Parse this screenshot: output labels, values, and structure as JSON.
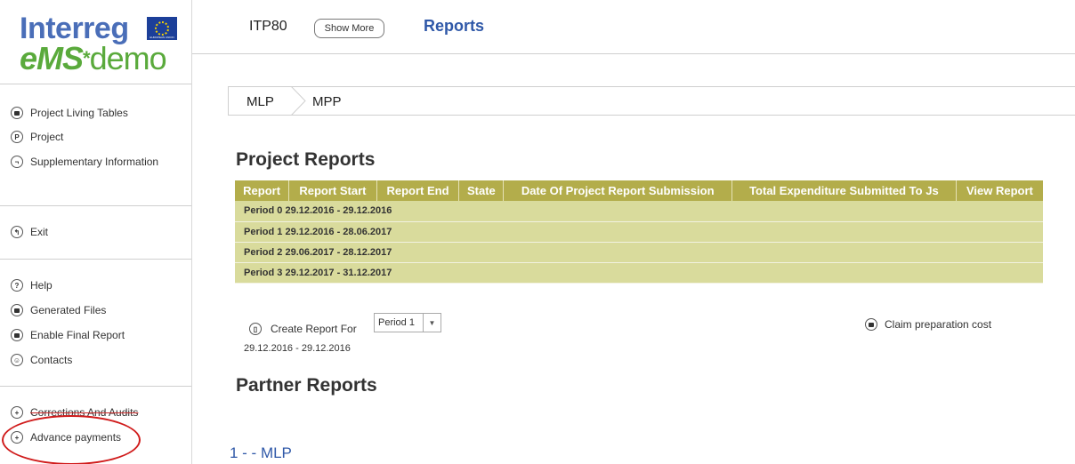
{
  "logo": {
    "top_text": "Interreg",
    "flag_caption": "EUROPEAN UNION",
    "ems_text": "eMS",
    "demo_text": "demo"
  },
  "sidebar": {
    "groups": [
      [
        {
          "label": "Project Living Tables",
          "icon": "square-icon"
        },
        {
          "label": "Project",
          "icon": "project-icon"
        },
        {
          "label": "Supplementary Information",
          "icon": "info-icon"
        }
      ],
      [
        {
          "label": "Exit",
          "icon": "exit-icon"
        }
      ],
      [
        {
          "label": "Help",
          "icon": "help-icon"
        },
        {
          "label": "Generated Files",
          "icon": "files-icon"
        },
        {
          "label": "Enable Final Report",
          "icon": "final-report-icon"
        },
        {
          "label": "Contacts",
          "icon": "contacts-icon"
        }
      ],
      [
        {
          "label": "Corrections And Audits",
          "icon": "plus-icon"
        },
        {
          "label": "Advance payments",
          "icon": "plus-icon"
        }
      ]
    ]
  },
  "header": {
    "project_code": "ITP80",
    "show_more": "Show More",
    "title": "Reports"
  },
  "breadcrumb": [
    "MLP",
    "MPP"
  ],
  "project_reports": {
    "title": "Project Reports",
    "columns": [
      "Report",
      "Report Start",
      "Report End",
      "State",
      "Date Of Project Report Submission",
      "Total Expenditure Submitted To Js",
      "View Report"
    ],
    "rows": [
      "Period 0 29.12.2016 - 29.12.2016",
      "Period 1 29.12.2016 - 28.06.2017",
      "Period 2 29.06.2017 - 28.12.2017",
      "Period 3 29.12.2017 - 31.12.2017"
    ],
    "header_color": "#b3ad4b",
    "row_color": "#d9db9c"
  },
  "controls": {
    "create_report_label": "Create Report For",
    "create_report_dates": "29.12.2016 - 29.12.2016",
    "period_selected": "Period 1",
    "claim_label": "Claim preparation cost"
  },
  "partner_reports": {
    "title": "Partner Reports",
    "first_partner": "1 - - MLP"
  },
  "accent_color": "#2f58a8",
  "highlight_color": "#d01b1b"
}
